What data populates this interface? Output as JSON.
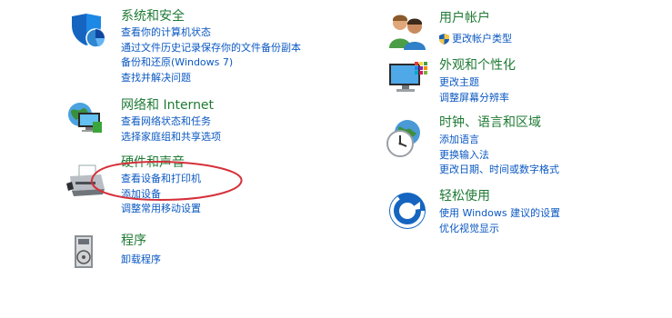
{
  "categories": [
    {
      "title": "系统和安全",
      "icon": "shield-icon",
      "links": [
        "查看你的计算机状态",
        "通过文件历史记录保存你的文件备份副本",
        "备份和还原(Windows 7)",
        "查找并解决问题"
      ]
    },
    {
      "title": "网络和 Internet",
      "icon": "network-icon",
      "links": [
        "查看网络状态和任务",
        "选择家庭组和共享选项"
      ]
    },
    {
      "title": "硬件和声音",
      "icon": "printer-icon",
      "links": [
        "查看设备和打印机",
        "添加设备",
        "调整常用移动设置"
      ]
    },
    {
      "title": "程序",
      "icon": "programs-icon",
      "links": [
        "卸载程序"
      ]
    },
    {
      "title": "用户帐户",
      "icon": "users-icon",
      "links": [
        "更改帐户类型"
      ]
    },
    {
      "title": "外观和个性化",
      "icon": "monitor-icon",
      "links": [
        "更改主题",
        "调整屏幕分辨率"
      ]
    },
    {
      "title": "时钟、语言和区域",
      "icon": "clock-icon",
      "links": [
        "添加语言",
        "更换输入法",
        "更改日期、时间或数字格式"
      ]
    },
    {
      "title": "轻松使用",
      "icon": "ease-of-access-icon",
      "links": [
        "使用 Windows 建议的设置",
        "优化视觉显示"
      ]
    }
  ],
  "colors": {
    "title": "#1f7a34",
    "link": "#0b58c2",
    "annotation": "#d6303a"
  }
}
